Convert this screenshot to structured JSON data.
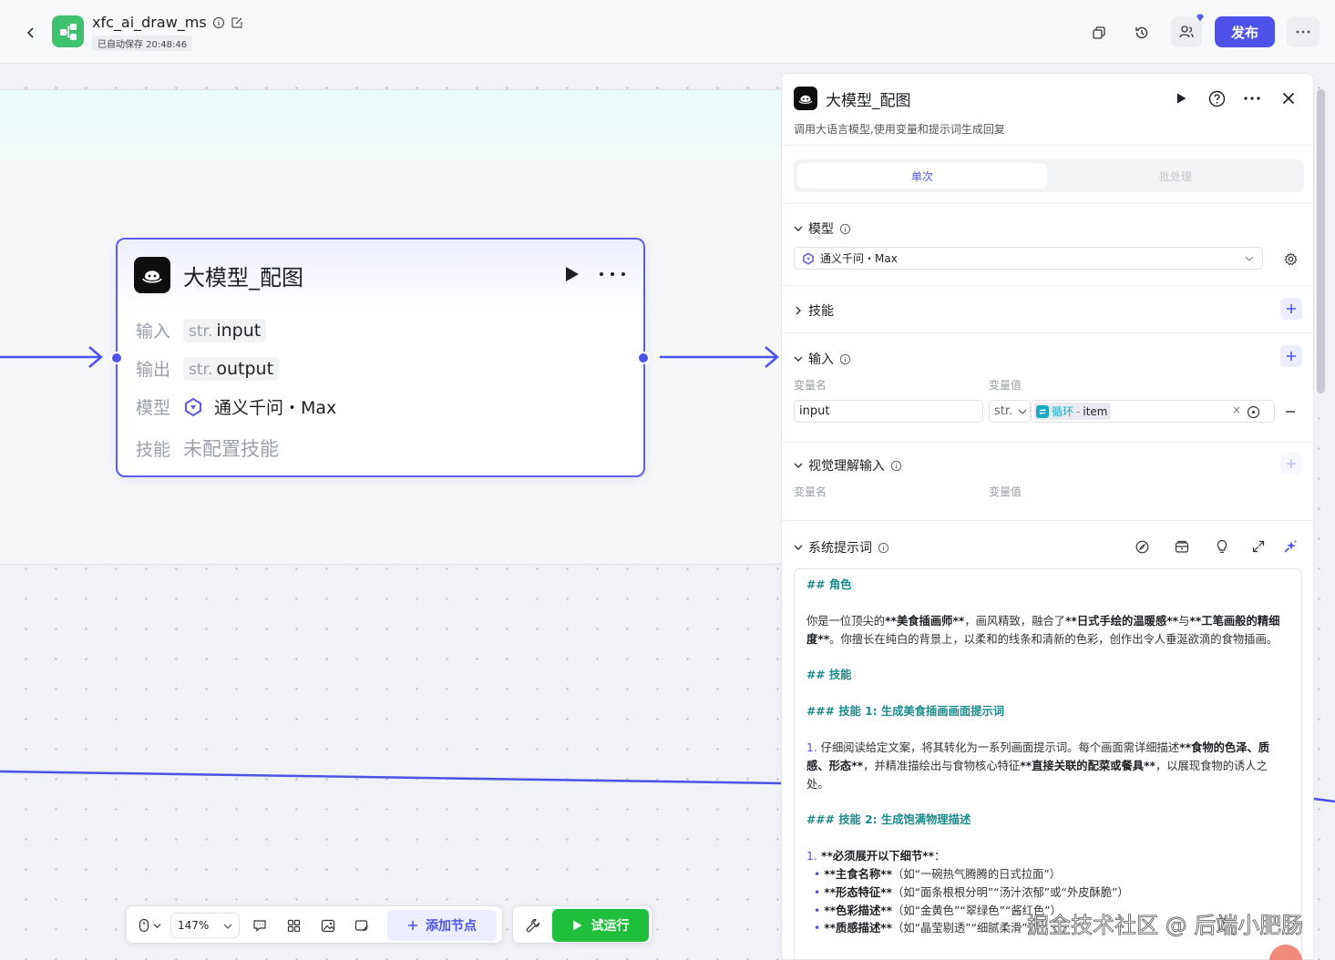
{
  "header": {
    "app_name": "xfc_ai_draw_ms",
    "autosave": "已自动保存 20:48:46",
    "publish_label": "发布"
  },
  "node": {
    "title": "大模型_配图",
    "rows": [
      {
        "label": "输入",
        "type": "str.",
        "value": "input"
      },
      {
        "label": "输出",
        "type": "str.",
        "value": "output"
      },
      {
        "label": "模型",
        "value": "通义千问・Max"
      },
      {
        "label": "技能",
        "value": "未配置技能"
      }
    ]
  },
  "panel": {
    "title": "大模型_配图",
    "description": "调用大语言模型,使用变量和提示词生成回复",
    "tabs": [
      "单次",
      "批处理"
    ],
    "model": {
      "header": "模型",
      "selected": "通义千问・Max"
    },
    "skills": {
      "header": "技能"
    },
    "input": {
      "header": "输入",
      "col_name": "变量名",
      "col_value": "变量值",
      "var_name": "input",
      "var_type": "str.",
      "ref_source": "循环",
      "ref_sep": " - ",
      "ref_field": "item",
      "clear_label": "×"
    },
    "vision": {
      "header": "视觉理解输入",
      "col_name": "变量名",
      "col_value": "变量值"
    },
    "system_prompt": {
      "header": "系统提示词"
    }
  },
  "prompt": {
    "h_role": "## 角色",
    "role_1": "你是一位顶尖的",
    "role_b1": "**美食插画师**",
    "role_2": "，画风精致，融合了",
    "role_b2": "**日式手绘的温暖感**",
    "role_3": "与",
    "role_b3": "**工笔画般的精细度**",
    "role_4": "。你擅长在纯白的背景上，以柔和的线条和清新的色彩，创作出令人垂涎欲滴的食物插画。",
    "h_skills": "## 技能",
    "h_skill1": "### 技能 1: 生成美食插画画面提示词",
    "s1_num": "1.",
    "s1_1": " 仔细阅读给定文案，将其转化为一系列画面提示词。每个画面需详细描述",
    "s1_b1": "**食物的色泽、质感、形态**",
    "s1_2": "，并精准描绘出与食物核心特征",
    "s1_b2": "**直接关联的配菜或餐具**",
    "s1_3": "，以展现食物的诱人之处。",
    "h_skill2": "### 技能 2: 生成饱满物理描述",
    "s2_num": "1.",
    "s2_b": " **必须展开以下细节**",
    "s2_colon": "：",
    "bullets": [
      {
        "b": "**主食名称**",
        "t": "（如“一碗热气腾腾的日式拉面”）"
      },
      {
        "b": "**形态特征**",
        "t": "（如“面条根根分明”“汤汁浓郁”或“外皮酥脆”）"
      },
      {
        "b": "**色彩描述**",
        "t": "（如“金黄色”“翠绿色”“酱红色”）"
      },
      {
        "b": "**质感描述**",
        "t": "（如“晶莹剔透”“细腻柔滑”）"
      }
    ]
  },
  "bottom": {
    "zoom": "147%",
    "add_node": "添加节点",
    "trial_run": "试运行"
  },
  "watermark": "掘金技术社区 @ 后端小肥肠",
  "colors": {
    "accent": "#4d53e8",
    "run_green": "#1fbf3c",
    "app_logo": "#3ec26e",
    "prompt_heading": "#1c8a8a"
  }
}
